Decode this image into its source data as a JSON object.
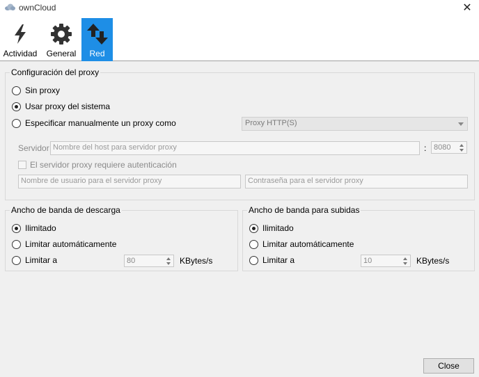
{
  "window": {
    "title": "ownCloud"
  },
  "toolbar": {
    "items": [
      {
        "label": "Actividad",
        "icon": "lightning-icon"
      },
      {
        "label": "General",
        "icon": "gear-icon"
      },
      {
        "label": "Red",
        "icon": "network-arrows-icon",
        "active": true
      }
    ],
    "accent": "#1e8ee6"
  },
  "proxy": {
    "title": "Configuración del proxy",
    "options": [
      "Sin proxy",
      "Usar proxy del sistema",
      "Especificar manualmente un proxy como"
    ],
    "selected": "Usar proxy del sistema",
    "type_value": "Proxy HTTP(S)",
    "server_label": "Servidor",
    "host_placeholder": "Nombre del host para servidor proxy",
    "port_separator": ":",
    "port_value": "8080",
    "auth_label": "El servidor proxy requiere autenticación",
    "user_placeholder": "Nombre de usuario para el servidor proxy",
    "password_placeholder": "Contraseña para el servidor proxy"
  },
  "download": {
    "title": "Ancho de banda de descarga",
    "options": [
      "Ilimitado",
      "Limitar automáticamente",
      "Limitar a"
    ],
    "selected": "Ilimitado",
    "limit_value": "80",
    "unit": "KBytes/s"
  },
  "upload": {
    "title": "Ancho de banda para subidas",
    "options": [
      "Ilimitado",
      "Limitar automáticamente",
      "Limitar a"
    ],
    "selected": "Ilimitado",
    "limit_value": "10",
    "unit": "KBytes/s"
  },
  "footer": {
    "close_label": "Close"
  }
}
